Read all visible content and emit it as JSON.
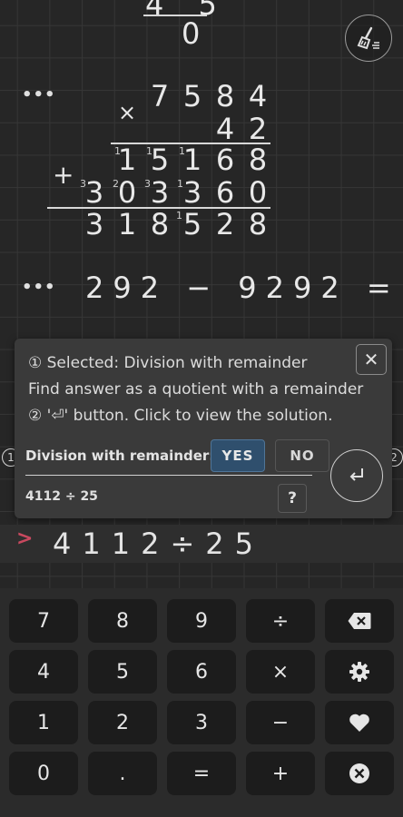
{
  "top_partial": {
    "line1": "4 5",
    "line2": "0"
  },
  "history": {
    "multiplication": {
      "operator": "×",
      "multiplicand": [
        "7",
        "5",
        "8",
        "4"
      ],
      "multiplier": [
        "4",
        "2"
      ],
      "partial1": [
        "1",
        "5",
        "1",
        "6",
        "8"
      ],
      "partial1_carries": [
        "1",
        "1",
        "1"
      ],
      "plus": "+",
      "partial2": [
        "3",
        "0",
        "3",
        "3",
        "6",
        "0"
      ],
      "partial2_carries": [
        "3",
        "2",
        "3",
        "1"
      ],
      "result": [
        "3",
        "1",
        "8",
        "5",
        "2",
        "8"
      ],
      "result_carries": [
        "1"
      ]
    },
    "subtraction": {
      "expression": "292 − 9292 ="
    },
    "more_label": "•••"
  },
  "popup": {
    "line1": "① Selected: Division with remainder",
    "line2": "Find answer as a quotient with a remainder",
    "line3": "② '⏎' button. Click to view the solution.",
    "close_label": "✕",
    "option_label": "Division with remainder:",
    "yes_label": "YES",
    "no_label": "NO",
    "expression": "4112 ÷ 25",
    "help_label": "?",
    "badge1": "1",
    "badge2": "2"
  },
  "input": {
    "prompt": ">",
    "expression": "4112÷25"
  },
  "keypad": {
    "rows": [
      [
        "7",
        "8",
        "9",
        "÷",
        "backspace-icon"
      ],
      [
        "4",
        "5",
        "6",
        "×",
        "gear-icon"
      ],
      [
        "1",
        "2",
        "3",
        "−",
        "heart-icon"
      ],
      [
        "0",
        ".",
        "=",
        "+",
        "clear-icon"
      ]
    ],
    "labels": {
      "k7": "7",
      "k8": "8",
      "k9": "9",
      "kdiv": "÷",
      "k4": "4",
      "k5": "5",
      "k6": "6",
      "kmul": "×",
      "k1": "1",
      "k2": "2",
      "k3": "3",
      "kminus": "−",
      "k0": "0",
      "kdot": ".",
      "keq": "=",
      "kplus": "+"
    }
  },
  "colors": {
    "background": "#262626",
    "prompt": "#c9495f",
    "yes_button": "#2f4f6d",
    "key": "#1c1c1c"
  }
}
